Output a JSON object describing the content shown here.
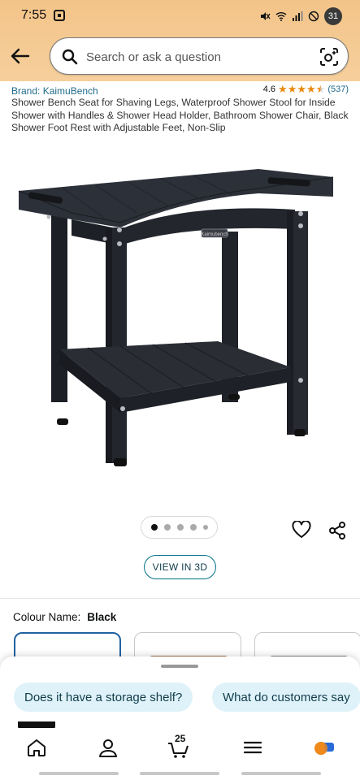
{
  "status_bar": {
    "time": "7:55",
    "battery": "31"
  },
  "search": {
    "placeholder": "Search or ask a question"
  },
  "product": {
    "brand": "Brand: KaimuBench",
    "rating_value": "4.6",
    "rating_stars": 4.5,
    "review_count": "(537)",
    "title": "Shower Bench Seat for Shaving Legs, Waterproof Shower Stool for Inside Shower with Handles & Shower Head Holder, Bathroom Shower Chair, Black Shower Foot Rest with Adjustable Feet, Non-Slip",
    "image_label": "Kaimubench"
  },
  "carousel": {
    "image_count": 5,
    "active_index": 0
  },
  "actions": {
    "view_3d": "VIEW IN 3D"
  },
  "colour": {
    "label": "Colour Name:",
    "value": "Black",
    "swatch_colors": [
      "#3a3d42",
      "#9a6a45",
      "#7c8087"
    ]
  },
  "suggestions": [
    "Does it have a storage shelf?",
    "What do customers say"
  ],
  "bottom_nav": {
    "cart_count": "25",
    "items": [
      "home-icon",
      "account-icon",
      "cart-icon",
      "menu-icon",
      "rufus-icon"
    ]
  },
  "colors": {
    "header_bg": "#f3c489",
    "link": "#1f6b8a",
    "star": "#e88a0e",
    "chip_bg": "#dff2f9",
    "selected_border": "#2162a1"
  }
}
